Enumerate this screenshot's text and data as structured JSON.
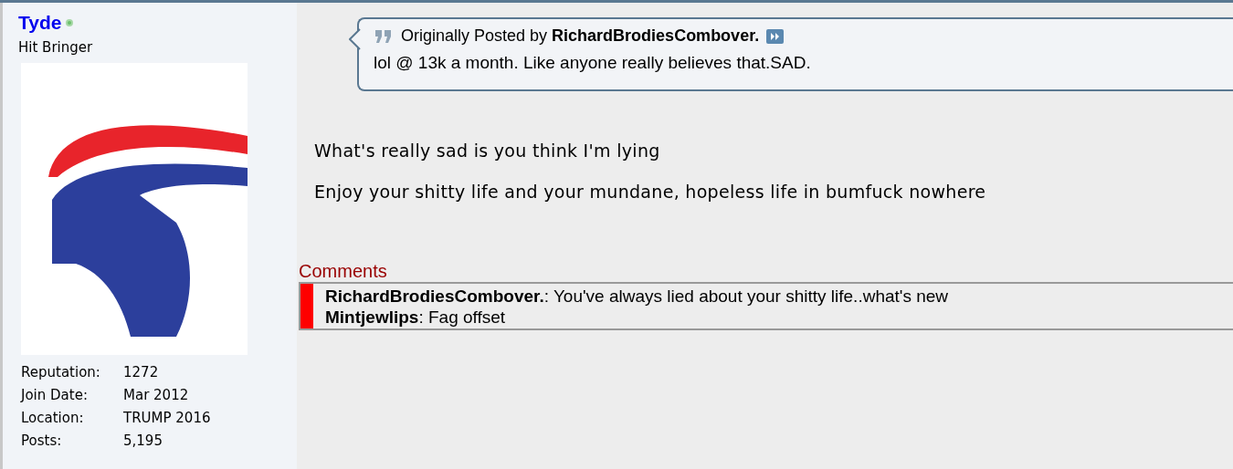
{
  "user": {
    "name": "Tyde",
    "online": true,
    "title": "Hit Bringer",
    "stats": [
      {
        "label": "Reputation:",
        "value": "1272"
      },
      {
        "label": "Join Date:",
        "value": "Mar 2012"
      },
      {
        "label": "Location:",
        "value": "TRUMP 2016"
      },
      {
        "label": "Posts:",
        "value": "5,195"
      }
    ]
  },
  "quote": {
    "prefix": "Originally Posted by",
    "author": "RichardBrodiesCombover.",
    "text": "lol @ 13k a month. Like anyone really believes that.SAD."
  },
  "post": [
    "What's really sad is you think I'm lying",
    "Enjoy your shitty life and your mundane, hopeless life in bumfuck nowhere"
  ],
  "comments": {
    "title": "Comments",
    "items": [
      {
        "author": "RichardBrodiesCombover.",
        "text": ": You've always lied about your shitty life..what's new"
      },
      {
        "author": "Mintjewlips",
        "text": ": Fag offset"
      }
    ]
  }
}
